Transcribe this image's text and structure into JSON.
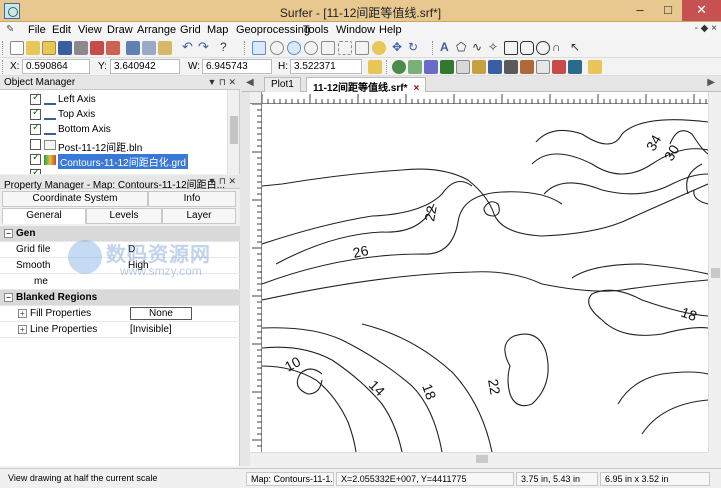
{
  "window": {
    "title": "Surfer - [11-12间距等值线.srf*]",
    "min": "–",
    "max": "□",
    "close": "✕"
  },
  "menu": [
    "File",
    "Edit",
    "View",
    "Draw",
    "Arrange",
    "Grid",
    "Map",
    "Geoprocessing",
    "Tools",
    "Window",
    "Help"
  ],
  "mdi": "- ◆ ×",
  "coords": {
    "x_label": "X:",
    "x_value": "0.590864",
    "y_label": "Y:",
    "y_value": "3.640942",
    "w_label": "W:",
    "w_value": "6.945743",
    "h_label": "H:",
    "h_value": "3.522371"
  },
  "object_manager": {
    "title": "Object Manager",
    "items": [
      {
        "label": "Left Axis",
        "checked": true
      },
      {
        "label": "Top Axis",
        "checked": true
      },
      {
        "label": "Bottom Axis",
        "checked": true
      },
      {
        "label": "Post-11-12间距.bln",
        "checked": false
      },
      {
        "label": "Contours-11-12间距白化.grd",
        "checked": true,
        "selected": true
      },
      {
        "label": "",
        "checked": true
      }
    ]
  },
  "property_manager": {
    "title": "Property Manager - Map: Contours-11-12间距白...",
    "tabs_top": [
      "Coordinate System",
      "Info"
    ],
    "tabs_bottom": [
      "General",
      "Levels",
      "Layer"
    ],
    "rows": [
      {
        "key": "Gen",
        "value": "",
        "section": true
      },
      {
        "key": "Grid file",
        "value": "D",
        "section": false
      },
      {
        "key": "Smooth",
        "value": "High",
        "section": false
      },
      {
        "key": "",
        "value": "me",
        "section": false
      },
      {
        "key": "Blanked Regions",
        "value": "",
        "section": true
      },
      {
        "key": "Fill Properties",
        "value": "None",
        "section": false,
        "expandable": true,
        "boxed": true
      },
      {
        "key": "Line Properties",
        "value": "[Invisible]",
        "section": false,
        "expandable": true
      }
    ]
  },
  "watermark": {
    "main": "数码资源网",
    "url": "www.smzy.com"
  },
  "doc_tabs": [
    {
      "label": "Plot1",
      "active": false
    },
    {
      "label": "11-12间距等值线.srf*",
      "active": true,
      "close": "×"
    }
  ],
  "contour_labels": [
    "34",
    "30",
    "22",
    "26",
    "18",
    "10",
    "14",
    "18",
    "22"
  ],
  "status": {
    "hint": "View drawing at half the current scale",
    "selection": "Map: Contours-11-1...",
    "position": "X=2.055332E+007, Y=4411775",
    "cursor": "3.75 in, 5.43 in",
    "size": "6.95 in x 3.52 in"
  },
  "colors": {
    "titlebar": "#e9c88f",
    "selection": "#3a78d8",
    "close_button": "#c75050"
  }
}
